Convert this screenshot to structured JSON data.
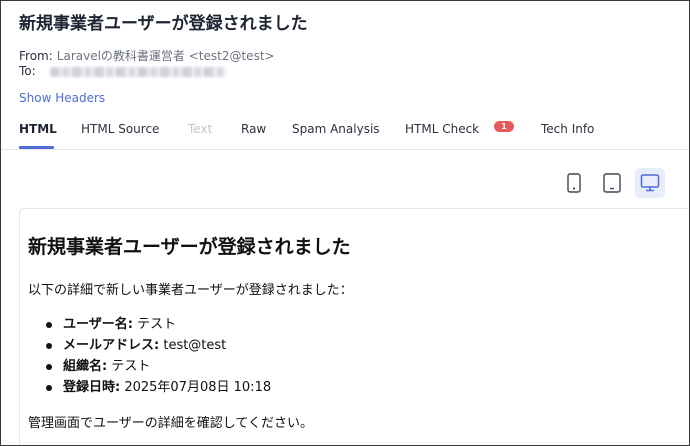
{
  "email": {
    "subject": "新規事業者ユーザーが登録されました",
    "from_label": "From:",
    "from_value": "Laravelの教科書運営者 <test2@test>",
    "to_label": "To:",
    "show_headers": "Show Headers"
  },
  "tabs": [
    {
      "label": "HTML",
      "state": "active"
    },
    {
      "label": "HTML Source",
      "state": "normal"
    },
    {
      "label": "Text",
      "state": "disabled"
    },
    {
      "label": "Raw",
      "state": "normal"
    },
    {
      "label": "Spam Analysis",
      "state": "normal"
    },
    {
      "label": "HTML Check",
      "state": "normal",
      "badge": "1"
    },
    {
      "label": "Tech Info",
      "state": "normal"
    }
  ],
  "device_toggle": {
    "options": [
      "mobile",
      "tablet",
      "desktop"
    ],
    "selected": "desktop"
  },
  "body": {
    "title": "新規事業者ユーザーが登録されました",
    "intro": "以下の詳細で新しい事業者ユーザーが登録されました：",
    "details": [
      {
        "key": "ユーザー名:",
        "value": "テスト"
      },
      {
        "key": "メールアドレス:",
        "value": "test@test"
      },
      {
        "key": "組織名:",
        "value": "テスト"
      },
      {
        "key": "登録日時:",
        "value": "2025年07月08日 10:18"
      }
    ],
    "outro": "管理画面でユーザーの詳細を確認してください。"
  },
  "colors": {
    "accent": "#4f6bd8",
    "badge": "#e55a5a",
    "disabled_text": "#c3c7ce",
    "device_active_bg": "#e8edfb"
  }
}
